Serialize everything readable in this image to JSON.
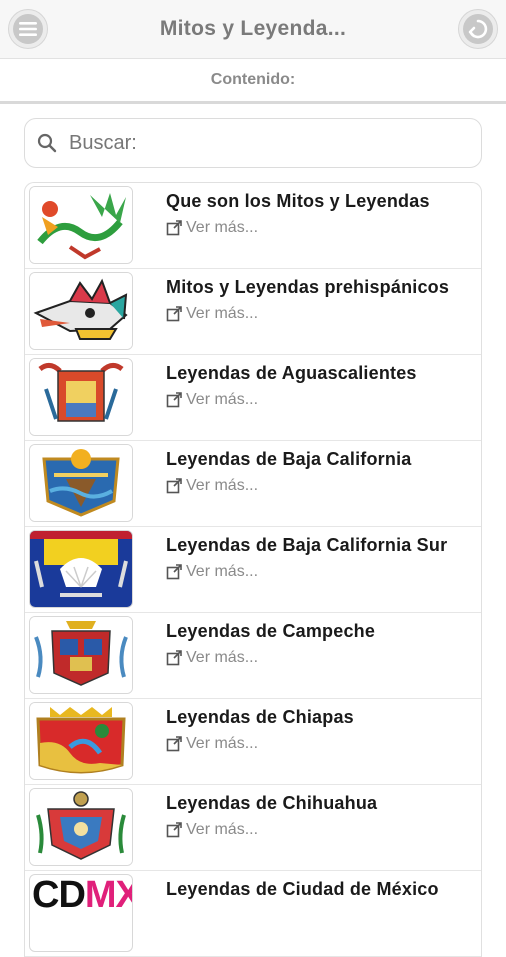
{
  "header": {
    "title": "Mitos y Leyenda...",
    "menu_icon": "menu-icon",
    "back_icon": "back-arrow-icon"
  },
  "subheader": {
    "label": "Contenido:"
  },
  "search": {
    "placeholder": "Buscar:",
    "value": "",
    "icon": "search-icon"
  },
  "list": {
    "more_label": "Ver más...",
    "items": [
      {
        "title": "Que son los Mitos y Leyendas",
        "thumb": "aztec-serpent-illustration"
      },
      {
        "title": "Mitos y Leyendas prehispánicos",
        "thumb": "aztec-glyph-head"
      },
      {
        "title": "Leyendas de Aguascalientes",
        "thumb": "coat-of-arms-aguascalientes"
      },
      {
        "title": "Leyendas de Baja California",
        "thumb": "coat-of-arms-baja-california"
      },
      {
        "title": "Leyendas de Baja California Sur",
        "thumb": "coat-of-arms-baja-california-sur"
      },
      {
        "title": "Leyendas de Campeche",
        "thumb": "coat-of-arms-campeche"
      },
      {
        "title": "Leyendas de Chiapas",
        "thumb": "coat-of-arms-chiapas"
      },
      {
        "title": "Leyendas de Chihuahua",
        "thumb": "coat-of-arms-chihuahua"
      },
      {
        "title": "Leyendas de Ciudad de México",
        "thumb": "cdmx-logo",
        "logo_text": "CDMX"
      }
    ]
  },
  "colors": {
    "header_bg": "#f7f7f7",
    "title": "#7a7a7a",
    "link": "#8a8a8a"
  }
}
